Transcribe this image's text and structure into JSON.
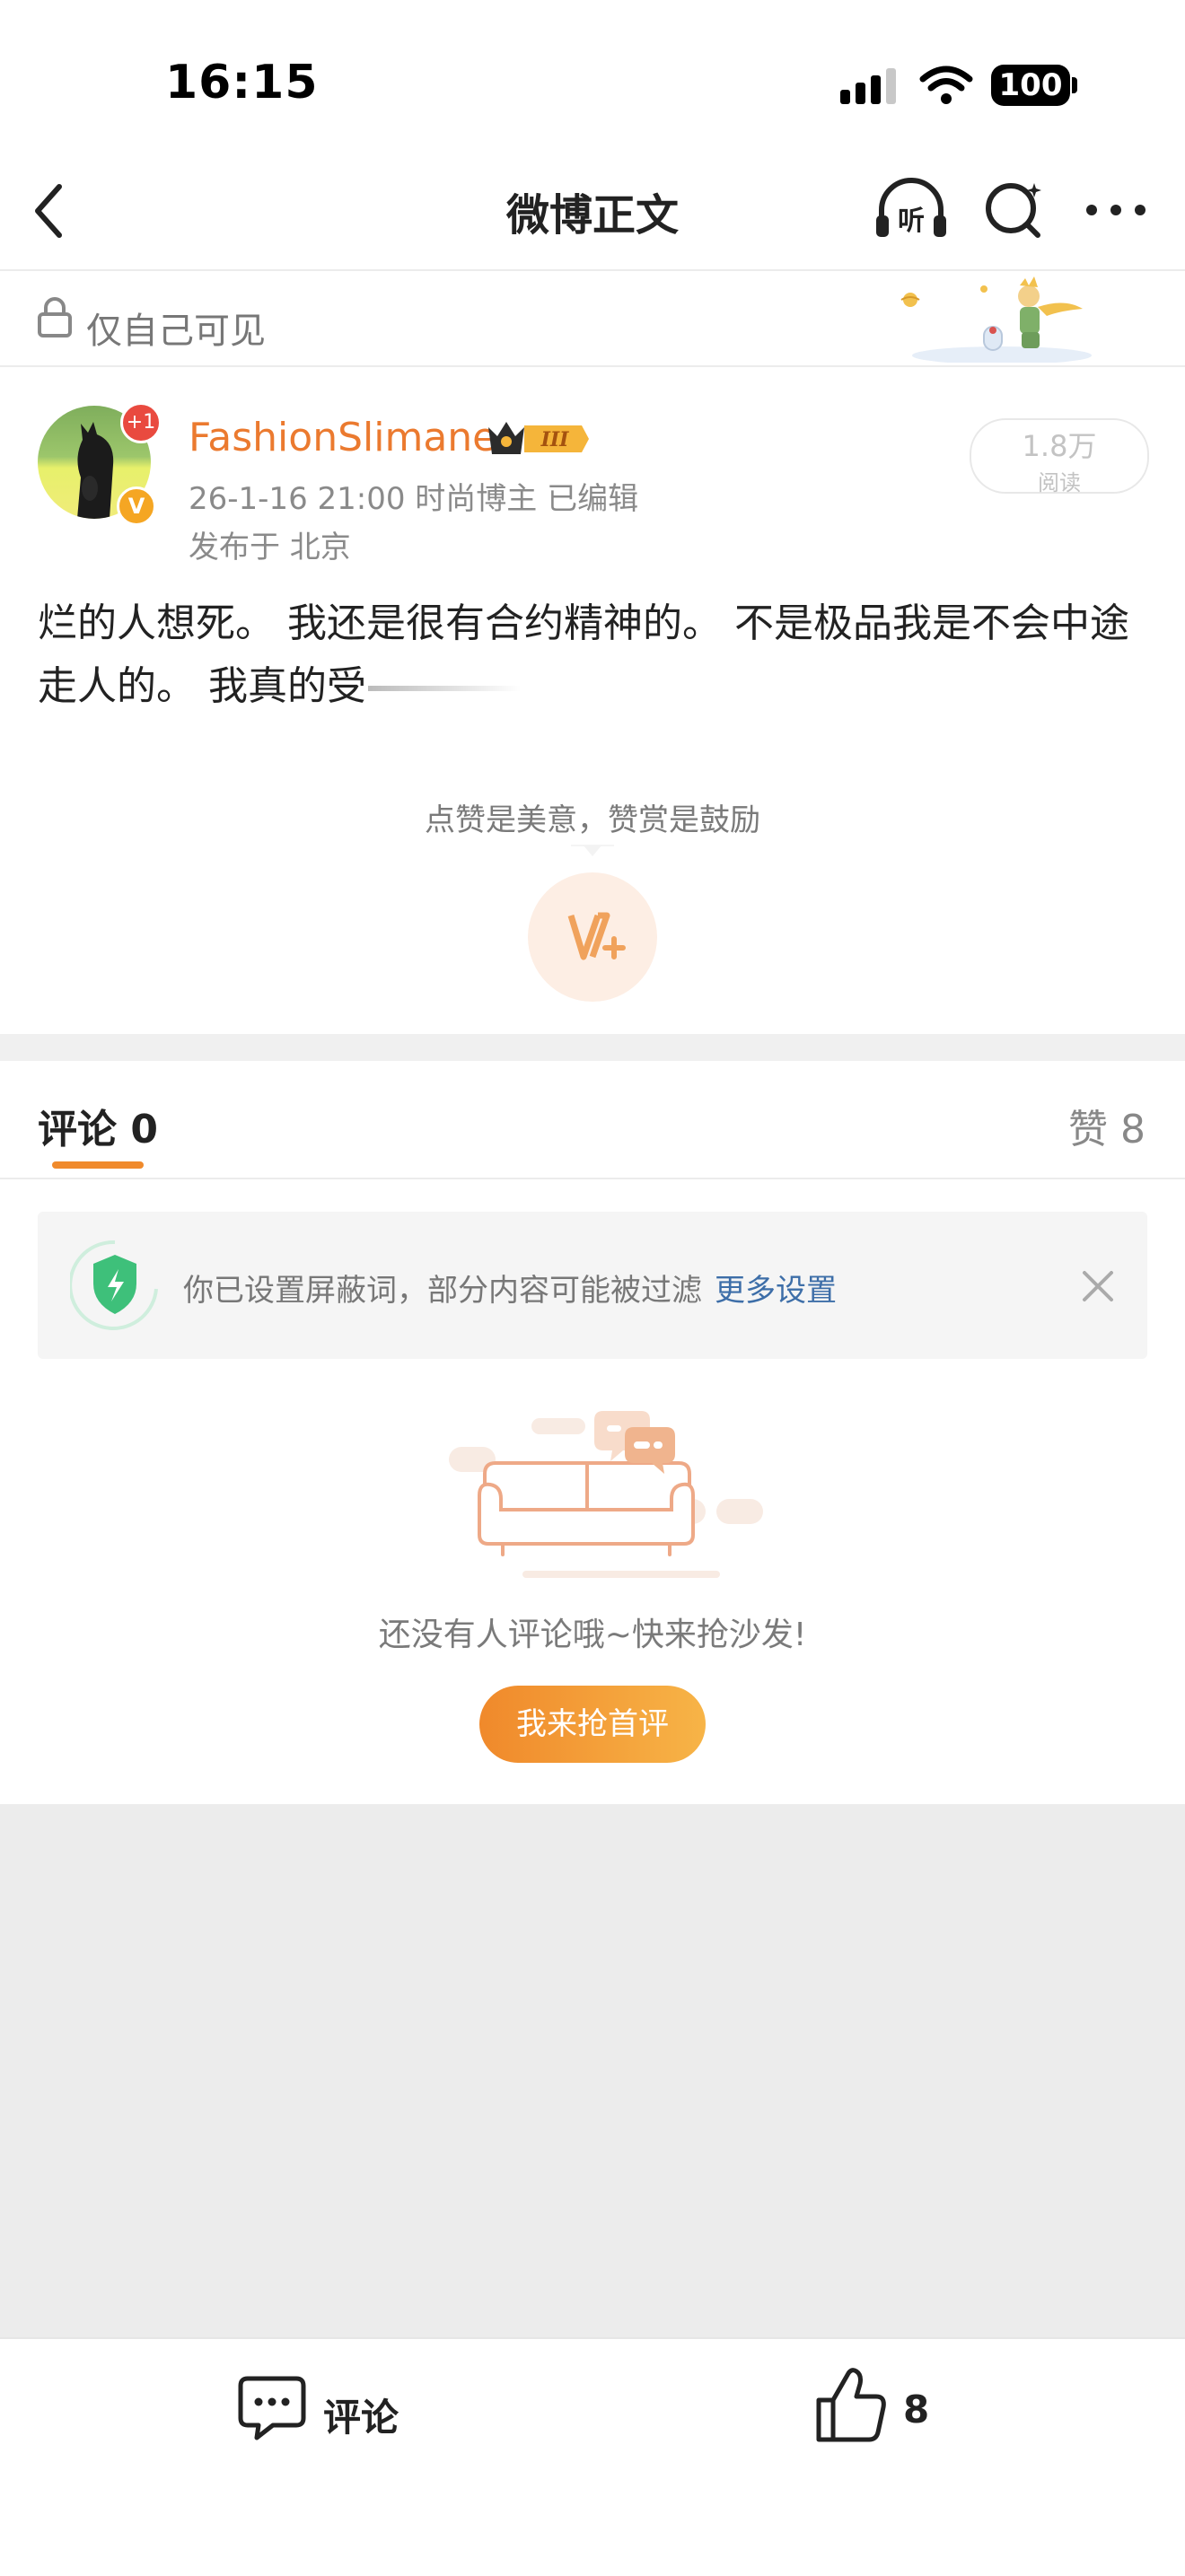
{
  "status_bar": {
    "time": "16:15",
    "battery": "100"
  },
  "nav": {
    "title": "微博正文"
  },
  "visibility": {
    "label": "仅自己可见"
  },
  "author": {
    "name": "FashionSlimane",
    "plus_badge": "+1",
    "verified_badge": "V",
    "level_badge": "III",
    "meta": "26-1-16 21:00  时尚博主  已编辑",
    "location": "发布于 北京",
    "reads": "1.8万",
    "reads_label": "阅读"
  },
  "post": {
    "text": "烂的人想死。 我还是很有合约精神的。 不是极品我是不会中途走人的。 我真的受"
  },
  "reward": {
    "tip": "点赞是美意，赞赏是鼓励"
  },
  "tabs": {
    "comments": "评论 0",
    "likes": "赞 8"
  },
  "filter_notice": {
    "text": "你已设置屏蔽词，部分内容可能被过滤",
    "link": "更多设置"
  },
  "empty_state": {
    "text": "还没有人评论哦~快来抢沙发!",
    "button": "我来抢首评"
  },
  "bottom_bar": {
    "comment_label": "评论",
    "like_count": "8"
  },
  "colors": {
    "accent": "#f08a2c",
    "author_name": "#eb7a2f",
    "link": "#3d6ea8",
    "background_gray": "#ececec"
  }
}
